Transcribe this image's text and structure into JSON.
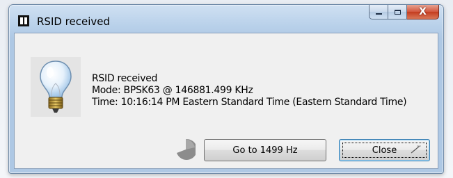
{
  "window": {
    "title": "RSID received"
  },
  "titlebar": {
    "icon": "app-icon",
    "buttons": [
      "minimize-icon",
      "maximize-icon",
      "close-icon"
    ],
    "close_glyph": "X"
  },
  "message": {
    "icon": "lightbulb-icon",
    "line1": "RSID received",
    "line2": "Mode: BPSK63 @ 146881.499 KHz",
    "line3": "Time: 10:16:14 PM Eastern Standard Time (Eastern Standard Time)"
  },
  "buttons": {
    "goto_label": "Go to 1499 Hz",
    "close_label": "Close"
  },
  "colors": {
    "titlebar": "#b9d1ea",
    "client": "#f0f0f0",
    "close_button": "#c43c1f",
    "default_button_border": "#3c7fb1"
  }
}
